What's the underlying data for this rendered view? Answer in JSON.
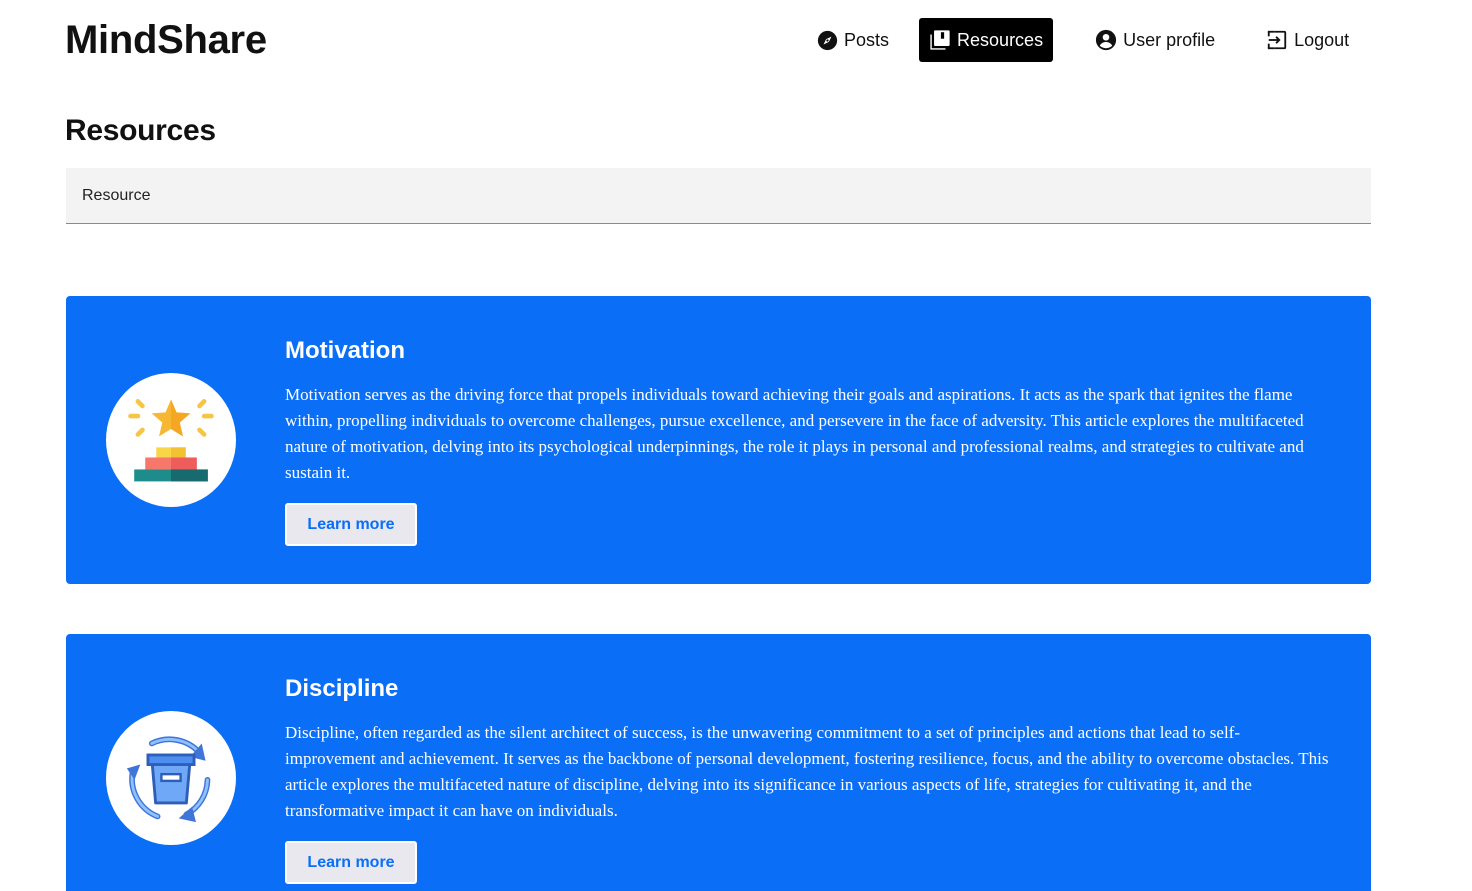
{
  "header": {
    "brand": "MindShare",
    "nav": [
      {
        "label": "Posts",
        "icon": "compass-icon"
      },
      {
        "label": "Resources",
        "icon": "library-icon",
        "active": true
      },
      {
        "label": "User profile",
        "icon": "user-circle-icon"
      },
      {
        "label": "Logout",
        "icon": "logout-icon"
      }
    ]
  },
  "main": {
    "title": "Resources",
    "search": {
      "placeholder": "Resource",
      "value": ""
    },
    "cards": [
      {
        "title": "Motivation",
        "icon": "trophy-podium-icon",
        "text": "Motivation serves as the driving force that propels individuals toward achieving their goals and aspirations. It acts as the spark that ignites the flame within, propelling individuals to overcome challenges, pursue excellence, and persevere in the face of adversity. This article explores the multifaceted nature of motivation, delving into its psychological underpinnings, the role it plays in personal and professional realms, and strategies to cultivate and sustain it.",
        "button": "Learn more"
      },
      {
        "title": "Discipline",
        "icon": "recycle-box-icon",
        "text": "Discipline, often regarded as the silent architect of success, is the unwavering commitment to a set of principles and actions that lead to self-improvement and achievement. It serves as the backbone of personal development, fostering resilience, focus, and the ability to overcome obstacles. This article explores the multifaceted nature of discipline, delving into its significance in various aspects of life, strategies for cultivating it, and the transformative impact it can have on individuals.",
        "button": "Learn more"
      }
    ]
  },
  "colors": {
    "card_background": "#0a6ef7",
    "active_nav_background": "#000000",
    "field_background": "#f3f3f3"
  }
}
